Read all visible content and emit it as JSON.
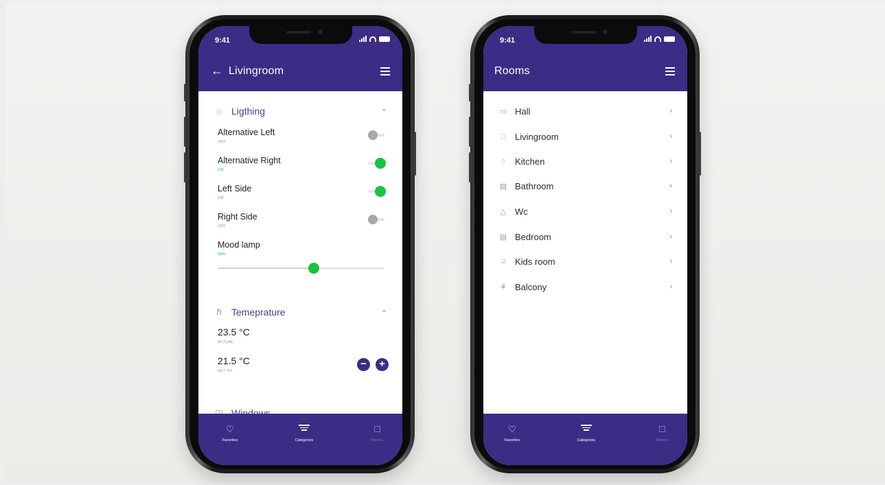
{
  "status_bar": {
    "time": "9:41"
  },
  "livingroom_screen": {
    "back_icon": "arrow-left-icon",
    "title": "Livingroom",
    "lighting": {
      "heading": "Ligthing",
      "items": [
        {
          "label": "Alternative Left",
          "state": "OFF",
          "on": false
        },
        {
          "label": "Alternative Right",
          "state": "ON",
          "on": true
        },
        {
          "label": "Left Side",
          "state": "ON",
          "on": true
        },
        {
          "label": "Right Side",
          "state": "OFF",
          "on": false
        }
      ],
      "mood_lamp": {
        "label": "Mood lamp",
        "value_text": "58%",
        "level": 0.58
      }
    },
    "temperature": {
      "heading": "Temeprature",
      "actual": {
        "value": "23.5",
        "unit": "°C",
        "label": "ACTUAL"
      },
      "set_to": {
        "value": "21.5",
        "unit": "°C",
        "label": "SET TO"
      }
    },
    "windows": {
      "heading": "Windows"
    }
  },
  "rooms_screen": {
    "title": "Rooms",
    "rooms": [
      {
        "label": "Hall",
        "icon": "hall-icon"
      },
      {
        "label": "Livingroom",
        "icon": "livingroom-icon"
      },
      {
        "label": "Kitchen",
        "icon": "kitchen-icon"
      },
      {
        "label": "Bathroom",
        "icon": "bathroom-icon"
      },
      {
        "label": "Wc",
        "icon": "wc-icon"
      },
      {
        "label": "Bedroom",
        "icon": "bedroom-icon"
      },
      {
        "label": "Kids room",
        "icon": "kids-room-icon"
      },
      {
        "label": "Balcony",
        "icon": "balcony-icon"
      }
    ]
  },
  "tabbar": {
    "favorites": "Favorites",
    "categories": "Categories",
    "rooms": "Rooms"
  },
  "colors": {
    "brand": "#3c2c86",
    "on": "#19c23f",
    "off": "#a8a8a8"
  }
}
